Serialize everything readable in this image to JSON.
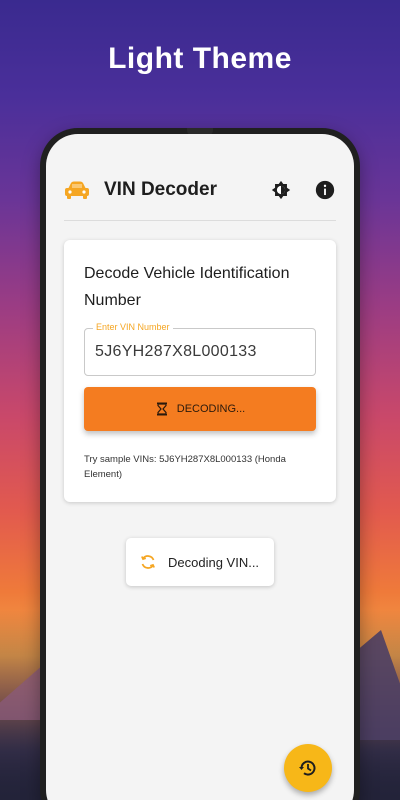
{
  "headline": "Light Theme",
  "app": {
    "title": "VIN Decoder",
    "accent_color": "#f47c20",
    "icons": {
      "car": "car-icon",
      "theme": "brightness-icon",
      "info": "info-icon",
      "history": "history-icon"
    }
  },
  "card": {
    "title": "Decode Vehicle Identification Number",
    "field": {
      "label": "Enter VIN Number",
      "value": "5J6YH287X8L000133"
    },
    "button_label": "DECODING...",
    "sample_text": "Try sample VINs: 5J6YH287X8L000133 (Honda Element)"
  },
  "status": {
    "text": "Decoding VIN..."
  }
}
